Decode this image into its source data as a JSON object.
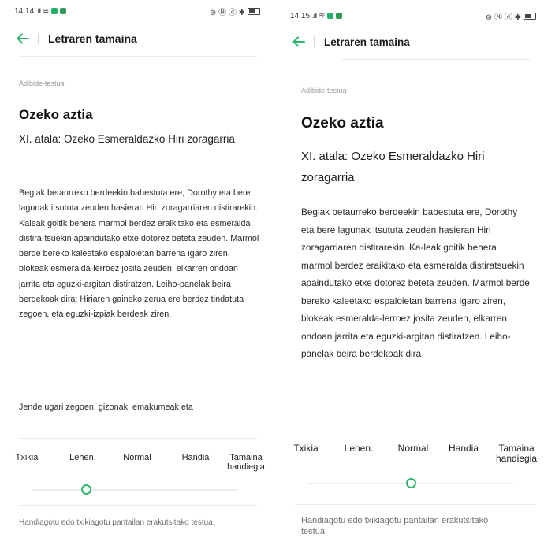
{
  "accent_color": "#2db56e",
  "screens": [
    {
      "status": {
        "time": "14:14",
        "signal": ".ıll",
        "right_icons": "⊛ Ⓝ ⓓ ✱"
      },
      "header": {
        "title": "Letraren tamaina"
      },
      "preview": {
        "section_label": "Adibide-testua",
        "title": "Ozeko aztia",
        "chapter": "XI. atala: Ozeko Esmeraldazko Hiri zoragarria",
        "body": "Begiak betaurreko berdeekin babestuta ere, Dorothy eta bere lagunak itsututa zeuden hasieran Hiri zoragarriaren distirarekin. Kaleak goitik behera marmol berdez eraikitako eta esmeralda distira-tsuekin apaindutako etxe dotorez beteta zeuden. Marmol berde bereko kaleetako espaloietan barrena igaro ziren, blokeak esmeralda-lerroez josita zeuden, elkarren ondoan jarrita eta eguzki-argitan distiratzen. Leiho-panelak beira berdekoak dira; Hiriaren gaineko zerua ere berdez tindatuta zegoen, eta eguzki-izpiak berdeak ziren.",
        "body2": "Jende ugari zegoen, gizonak, emakumeak eta"
      },
      "size_options": [
        "Txikia",
        "Lehen.",
        "Normal",
        "Handia",
        "Tamaina handiegia"
      ],
      "selected_size": "Lehen.",
      "footer": "Handiagotu edo txikiagotu pantailan erakutsitako testua."
    },
    {
      "status": {
        "time": "14:15",
        "signal": ".ıll",
        "right_icons": "⊛ Ⓝ ⓓ ✱"
      },
      "header": {
        "title": "Letraren tamaina"
      },
      "preview": {
        "section_label": "Adibide-testua",
        "title": "Ozeko aztia",
        "chapter": "XI. atala: Ozeko Esmeraldazko Hiri zoragarria",
        "body": "Begiak betaurreko berdeekin babestuta ere, Dorothy eta bere lagunak itsututa zeuden hasieran Hiri zoragarriaren distirarekin. Ka-leak goitik behera marmol berdez eraikitako eta esmeralda distiratsuekin apaindutako etxe dotorez beteta zeuden. Marmol berde bereko kaleetako espaloietan barrena igaro ziren, blokeak esmeralda-lerroez josita zeuden, elkarren ondoan jarrita eta eguzki-argitan distiratzen. Leiho-panelak beira berdekoak dira",
        "body2": ""
      },
      "size_options": [
        "Txikia",
        "Lehen.",
        "Normal",
        "Handia",
        "Tamaina handiegia"
      ],
      "selected_size": "Normal",
      "footer": "Handiagotu edo txikiagotu pantailan erakutsitako testua."
    }
  ]
}
